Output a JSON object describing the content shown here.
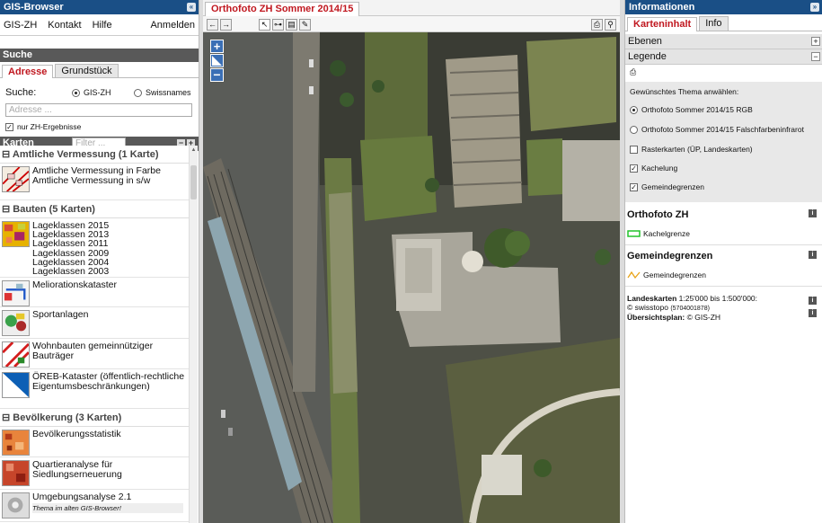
{
  "left": {
    "title": "GIS-Browser",
    "menu": [
      "GIS-ZH",
      "Kontakt",
      "Hilfe"
    ],
    "login": "Anmelden",
    "search": {
      "header": "Suche",
      "tabs": [
        "Adresse",
        "Grundstück"
      ],
      "label": "Suche:",
      "option1": "GIS-ZH",
      "option2": "Swissnames",
      "placeholder": "Adresse ...",
      "checkbox": "nur ZH-Ergebnisse"
    },
    "maps": {
      "header": "Karten",
      "filter_placeholder": "Filter ...",
      "sections": [
        {
          "title": "Amtliche Vermessung (1 Karte)",
          "items": [
            {
              "lines": [
                "Amtliche Vermessung in Farbe",
                "Amtliche Vermessung in s/w"
              ]
            }
          ]
        },
        {
          "title": "Bauten (5 Karten)",
          "items": [
            {
              "lines": [
                "Lageklassen 2015",
                "Lageklassen 2013",
                "Lageklassen 2011",
                "Lageklassen 2009",
                "Lageklassen 2004",
                "Lageklassen 2003"
              ]
            },
            {
              "lines": [
                "Meliorationskataster"
              ]
            },
            {
              "lines": [
                "Sportanlagen"
              ]
            },
            {
              "lines": [
                "Wohnbauten gemeinnütziger Bauträger"
              ]
            },
            {
              "lines": [
                "ÖREB-Kataster (öffentlich-rechtliche",
                "Eigentumsbeschränkungen)"
              ]
            }
          ]
        },
        {
          "title": "Bevölkerung (3 Karten)",
          "items": [
            {
              "lines": [
                "Bevölkerungsstatistik"
              ]
            },
            {
              "lines": [
                "Quartieranalyse für Siedlungserneuerung"
              ]
            },
            {
              "lines": [
                "Umgebungsanalyse 2.1"
              ],
              "note": "Thema im alten GIS-Browser!"
            }
          ]
        }
      ]
    }
  },
  "map": {
    "tab": "Orthofoto ZH Sommer 2014/15"
  },
  "right": {
    "title": "Informationen",
    "tabs": [
      "Karteninhalt",
      "Info"
    ],
    "ebenen": "Ebenen",
    "legende": "Legende",
    "theme_label": "Gewünschtes Thema anwählen:",
    "themes": [
      {
        "label": "Orthofoto Sommer 2014/15 RGB",
        "type": "radio",
        "checked": true
      },
      {
        "label": "Orthofoto Sommer 2014/15 Falschfarbeninfrarot",
        "type": "radio",
        "checked": false
      },
      {
        "label": "Rasterkarten (ÜP, Landeskarten)",
        "type": "check",
        "checked": false
      },
      {
        "label": "Kachelung",
        "type": "check",
        "checked": true
      },
      {
        "label": "Gemeindegrenzen",
        "type": "check",
        "checked": true
      }
    ],
    "ortho_header": "Orthofoto ZH",
    "kachelgrenze": "Kachelgrenze",
    "gemeinde_header": "Gemeindegrenzen",
    "gemeinde_item": "Gemeindegrenzen",
    "landeskarten_bold": "Landeskarten",
    "landeskarten_rest": " 1:25'000 bis 1:500'000:",
    "swisstopo": "© swisstopo",
    "swisstopo_code": "(5704001878)",
    "uebersicht_bold": "Übersichtsplan:",
    "uebersicht_rest": " © GIS-ZH"
  },
  "colors": {
    "accent_red": "#c0171f",
    "header_blue": "#1a4f86",
    "legend_green": "#22c42b",
    "legend_orange": "#e8a318"
  }
}
